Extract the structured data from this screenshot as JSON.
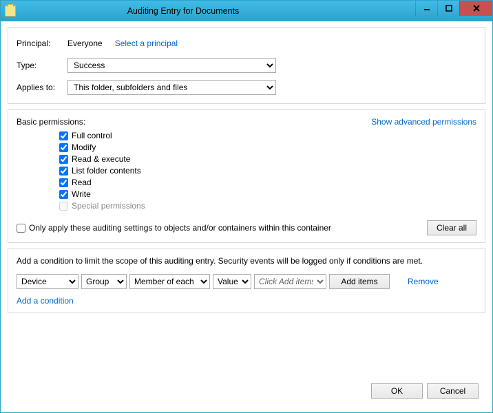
{
  "titlebar": {
    "title": "Auditing Entry for Documents"
  },
  "top": {
    "principal_label": "Principal:",
    "principal_value": "Everyone",
    "select_principal": "Select a principal",
    "type_label": "Type:",
    "type_value": "Success",
    "applies_label": "Applies to:",
    "applies_value": "This folder, subfolders and files"
  },
  "perms": {
    "header": "Basic permissions:",
    "show_advanced": "Show advanced permissions",
    "items": [
      {
        "label": "Full control",
        "checked": true,
        "enabled": true
      },
      {
        "label": "Modify",
        "checked": true,
        "enabled": true
      },
      {
        "label": "Read & execute",
        "checked": true,
        "enabled": true
      },
      {
        "label": "List folder contents",
        "checked": true,
        "enabled": true
      },
      {
        "label": "Read",
        "checked": true,
        "enabled": true
      },
      {
        "label": "Write",
        "checked": true,
        "enabled": true
      },
      {
        "label": "Special permissions",
        "checked": false,
        "enabled": false
      }
    ],
    "only_apply_label": "Only apply these auditing settings to objects and/or containers within this container",
    "clear_all": "Clear all"
  },
  "cond": {
    "intro": "Add a condition to limit the scope of this auditing entry. Security events will be logged only if conditions are met.",
    "device": "Device",
    "group": "Group",
    "member": "Member of each",
    "value": "Value",
    "items_placeholder": "Click Add items",
    "add_items": "Add items",
    "remove": "Remove",
    "add_condition": "Add a condition"
  },
  "footer": {
    "ok": "OK",
    "cancel": "Cancel"
  }
}
